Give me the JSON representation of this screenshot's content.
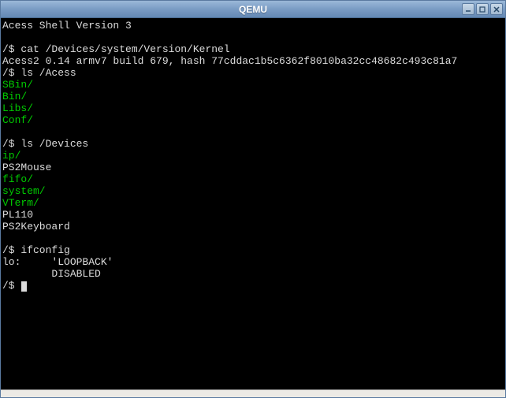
{
  "window": {
    "title": "QEMU"
  },
  "terminal": {
    "banner": "Acess Shell Version 3",
    "cmd1": {
      "prompt": "/$ ",
      "text": "cat /Devices/system/Version/Kernel"
    },
    "out1": "Acess2 0.14 armv7 build 679, hash 77cddac1b5c6362f8010ba32cc48682c493c81a7",
    "cmd2": {
      "prompt": "/$ ",
      "text": "ls /Acess"
    },
    "ls_acess": [
      "SBin/",
      "Bin/",
      "Libs/",
      "Conf/"
    ],
    "cmd3": {
      "prompt": "/$ ",
      "text": "ls /Devices"
    },
    "ls_dev": [
      {
        "t": "ip/",
        "c": "g"
      },
      {
        "t": "PS2Mouse",
        "c": "w"
      },
      {
        "t": "fifo/",
        "c": "g"
      },
      {
        "t": "system/",
        "c": "g"
      },
      {
        "t": "VTerm/",
        "c": "g"
      },
      {
        "t": "PL110",
        "c": "w"
      },
      {
        "t": "PS2Keyboard",
        "c": "w"
      }
    ],
    "cmd4": {
      "prompt": "/$ ",
      "text": "ifconfig"
    },
    "ifconfig": [
      "lo:     'LOOPBACK'",
      "        DISABLED"
    ],
    "cmd5": {
      "prompt": "/$ "
    }
  }
}
